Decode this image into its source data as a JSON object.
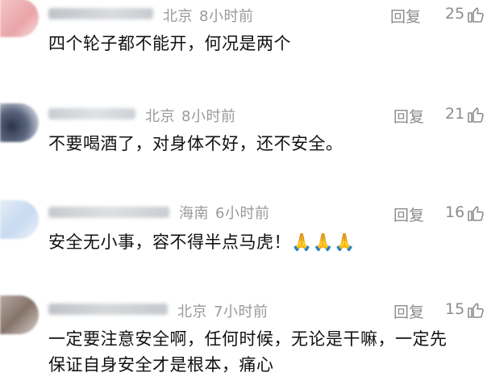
{
  "comments": [
    {
      "location": "北京",
      "time": "8小时前",
      "reply_label": "回复",
      "likes": "25",
      "text": "四个轮子都不能开，何况是两个"
    },
    {
      "location": "北京",
      "time": "8小时前",
      "reply_label": "回复",
      "likes": "21",
      "text": "不要喝酒了，对身体不好，还不安全。"
    },
    {
      "location": "海南",
      "time": "6小时前",
      "reply_label": "回复",
      "likes": "16",
      "text": "安全无小事，容不得半点马虎！🙏🙏🙏"
    },
    {
      "location": "北京",
      "time": "7小时前",
      "reply_label": "回复",
      "likes": "15",
      "text_line1": "一定要注意安全啊，任何时候，无论是干嘛，一定先",
      "text_line2": "保证自身安全才是根本，痛心"
    }
  ],
  "icons": {
    "like": "thumbs-up-icon"
  },
  "colors": {
    "meta_text": "#9a9a9a",
    "action_text": "#8c8c8c",
    "body_text": "#111111"
  }
}
